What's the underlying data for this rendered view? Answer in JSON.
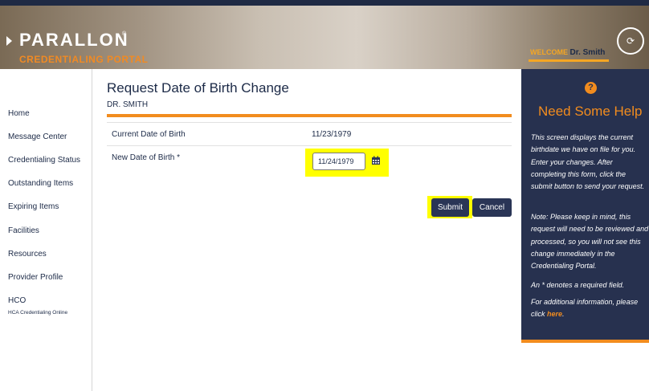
{
  "header": {
    "brand_name": "PARALLON",
    "brand_tm": "®",
    "brand_sub": "CREDENTIALING PORTAL",
    "welcome_label": "WELCOME",
    "welcome_name": "Dr. Smith",
    "logout_glyph": "⟳"
  },
  "sidebar": {
    "items": [
      {
        "label": "Home"
      },
      {
        "label": "Message Center"
      },
      {
        "label": "Credentialing Status"
      },
      {
        "label": "Outstanding Items"
      },
      {
        "label": "Expiring Items"
      },
      {
        "label": "Facilities"
      },
      {
        "label": "Resources"
      },
      {
        "label": "Provider Profile"
      },
      {
        "label": "HCO"
      }
    ],
    "hco_sub": "HCA Credentialing Online"
  },
  "main": {
    "title": "Request Date of Birth Change",
    "subtitle": "DR. SMITH",
    "current_label": "Current Date of Birth",
    "current_value": "11/23/1979",
    "new_label": "New Date of Birth *",
    "new_value": "11/24/1979",
    "submit_label": "Submit",
    "cancel_label": "Cancel"
  },
  "help": {
    "icon_glyph": "?",
    "title": "Need Some Help",
    "p1": "This screen displays the current birthdate we have on file for you. Enter your changes. After completing this form, click the submit button to send your request.",
    "p2": "Note: Please keep in mind, this request will need to be reviewed and processed, so you will not see this change immediately in the Credentialing Portal.",
    "p3": "An * denotes a required field.",
    "p4_pre": "For additional information, please click",
    "p4_link": "here",
    "p4_post": "."
  },
  "colors": {
    "navy": "#27314f",
    "orange": "#f28c1e",
    "highlight": "#ffff00"
  },
  "icons": [
    "logout-icon",
    "calendar-icon",
    "help-question-icon",
    "brand-arrow-icon"
  ]
}
